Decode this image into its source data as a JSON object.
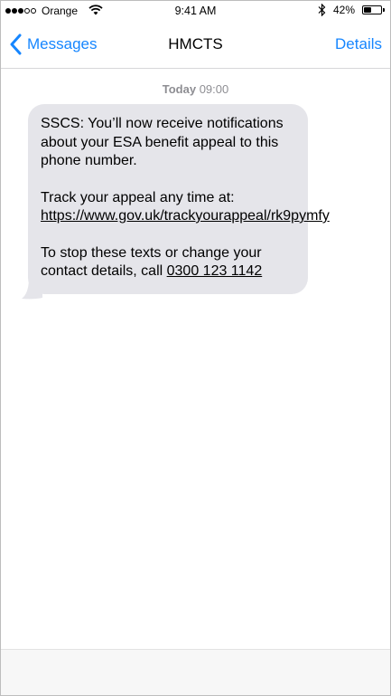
{
  "status_bar": {
    "signal_filled": 3,
    "signal_total": 5,
    "carrier": "Orange",
    "time": "9:41 AM",
    "battery_percent": "42%",
    "battery_level": 0.42,
    "icons": [
      "wifi-icon",
      "bluetooth-icon",
      "battery-icon"
    ]
  },
  "nav": {
    "back_label": "Messages",
    "title": "HMCTS",
    "details_label": "Details"
  },
  "conversation": {
    "timestamp_day": "Today",
    "timestamp_time": "09:00",
    "message": {
      "line1": "SSCS: You’ll now receive notifications about your ESA benefit appeal to this phone number.",
      "track_prefix": "Track your appeal any time at: ",
      "track_url": "https://www.gov.uk/trackyourappeal/rk9pymfy",
      "stop_prefix": "To stop these texts or change your contact details, call ",
      "stop_phone": "0300 123 1142"
    }
  },
  "colors": {
    "accent": "#1686ff",
    "bubble": "#e5e5ea",
    "timestamp": "#8e8e93"
  }
}
